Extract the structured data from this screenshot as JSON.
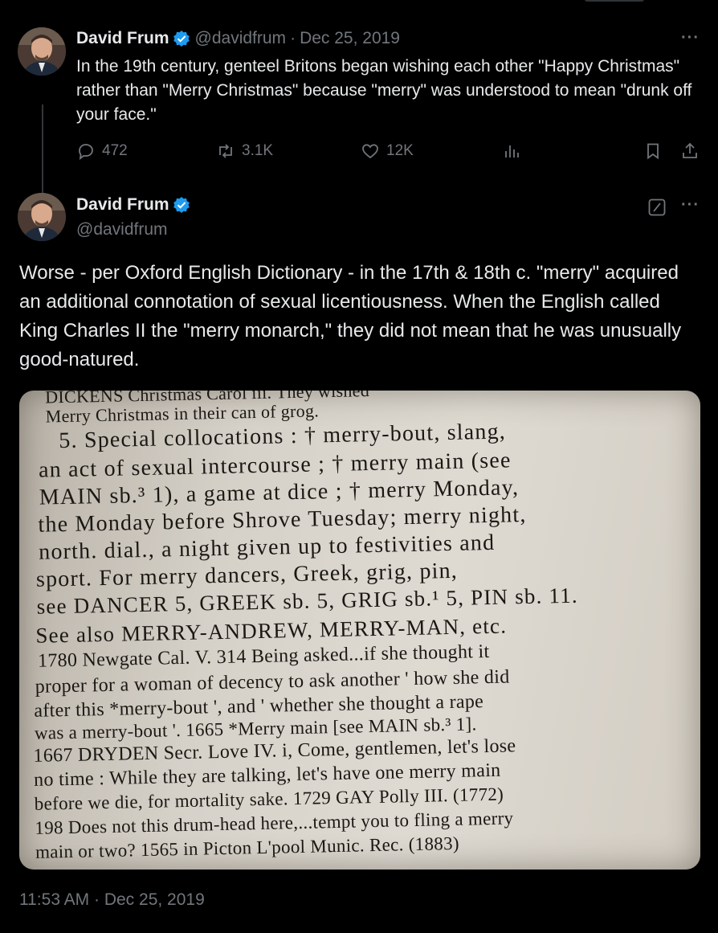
{
  "parent_tweet": {
    "display_name": "David Frum",
    "handle": "@davidfrum",
    "date": "Dec 25, 2019",
    "text": "In the 19th century, genteel Britons began wishing each other \"Happy Christmas\" rather than \"Merry Christmas\" because \"merry\" was understood to mean \"drunk off your face.\"",
    "replies": "472",
    "reposts": "3.1K",
    "likes": "12K"
  },
  "main_tweet": {
    "display_name": "David Frum",
    "handle": "@davidfrum",
    "text": "Worse - per Oxford English Dictionary - in the 17th & 18th c. \"merry\" acquired an additional connotation of sexual licentiousness. When the English called King Charles II the \"merry monarch,\" they did not mean that he was unusually good-natured.",
    "timestamp": "11:53 AM · Dec 25, 2019"
  },
  "dictionary_image": {
    "lines": [
      "DICKENS Christmas Carol iii. They wished",
      "Merry Christmas in their can of grog.",
      "5. Special collocations : † merry-bout, slang,",
      "an act of sexual intercourse ; † merry main (see",
      "MAIN sb.³ 1), a game at dice ; † merry Monday,",
      "the Monday before Shrove Tuesday; merry night,",
      "north. dial., a night given up to festivities and",
      "sport. For merry dancers, Greek, grig, pin,",
      "see DANCER 5, GREEK sb. 5, GRIG sb.¹ 5, PIN sb. 11.",
      "See also MERRY-ANDREW, MERRY-MAN, etc.",
      "1780 Newgate Cal. V. 314 Being asked...if she thought it",
      "proper for a woman of decency to ask another ' how she did",
      "after this *merry-bout ', and ' whether she thought a rape",
      "was a merry-bout '.    1665 *Merry main [see MAIN sb.³ 1].",
      "1667 DRYDEN Secr. Love IV. i, Come, gentlemen, let's lose",
      "no time : While they are talking, let's have one merry main",
      "before we die, for mortality sake.   1729 GAY Polly III. (1772)",
      "198 Does not this drum-head here,...tempt you to fling a merry",
      "main or two?   1565 in Picton L'pool Munic. Rec. (1883)"
    ]
  },
  "colors": {
    "background": "#000000",
    "text": "#e7e9ea",
    "muted": "#71767b",
    "verified": "#1d9bf0"
  }
}
